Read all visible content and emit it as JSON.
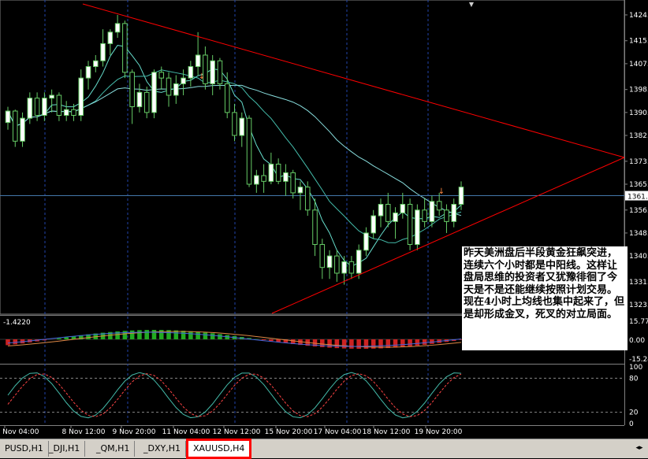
{
  "chart_data": [
    {
      "type": "candlestick",
      "symbol": "XAUUSD,H4",
      "y_ticks": [
        "1424.",
        "1415.",
        "1407.",
        "1398.",
        "1390.",
        "1382.",
        "1373.",
        "1365.",
        "1356.",
        "1348.",
        "1340.",
        "1331.",
        "1323."
      ],
      "current_price_label": "1361.",
      "ylim": [
        1320,
        1427
      ],
      "x_ticks": [
        "5 Nov 04:00",
        "8 Nov 12:00",
        "9 Nov 20:00",
        "11 Nov 04:00",
        "12 Nov 12:00",
        "15 Nov 20:00",
        "17 Nov 04:00",
        "18 Nov 12:00",
        "19 Nov 20:00"
      ],
      "candles": [
        [
          1386.5,
          1392,
          1384,
          1390.5
        ],
        [
          1390.5,
          1391,
          1378,
          1380
        ],
        [
          1380,
          1390,
          1378,
          1388
        ],
        [
          1388,
          1397,
          1386,
          1395
        ],
        [
          1395,
          1397,
          1387,
          1389
        ],
        [
          1389,
          1397,
          1387,
          1395
        ],
        [
          1395,
          1398,
          1390,
          1396
        ],
        [
          1396,
          1397,
          1387,
          1389
        ],
        [
          1389,
          1394,
          1387,
          1391
        ],
        [
          1391,
          1393,
          1387,
          1389
        ],
        [
          1389,
          1405,
          1387,
          1402
        ],
        [
          1402,
          1408,
          1398,
          1406
        ],
        [
          1406,
          1410,
          1404,
          1408
        ],
        [
          1408,
          1419,
          1406,
          1414
        ],
        [
          1414,
          1419,
          1410,
          1418
        ],
        [
          1418,
          1424,
          1416,
          1421
        ],
        [
          1421,
          1422,
          1402,
          1404
        ],
        [
          1404,
          1405,
          1386,
          1392
        ],
        [
          1392,
          1400,
          1390,
          1397
        ],
        [
          1397,
          1399,
          1388,
          1390
        ],
        [
          1390,
          1405,
          1388,
          1404
        ],
        [
          1404,
          1406,
          1398,
          1402
        ],
        [
          1402,
          1404,
          1392,
          1396
        ],
        [
          1396,
          1403,
          1393,
          1400
        ],
        [
          1400,
          1405,
          1396,
          1402
        ],
        [
          1402,
          1408,
          1399,
          1406
        ],
        [
          1406,
          1418,
          1403,
          1410
        ],
        [
          1410,
          1413,
          1398,
          1400
        ],
        [
          1400,
          1410,
          1396,
          1408
        ],
        [
          1408,
          1409,
          1398,
          1400
        ],
        [
          1400,
          1404,
          1388,
          1390
        ],
        [
          1390,
          1393,
          1380,
          1382
        ],
        [
          1382,
          1390,
          1378,
          1388
        ],
        [
          1388,
          1389,
          1364,
          1365
        ],
        [
          1365,
          1370,
          1362,
          1368
        ],
        [
          1368,
          1372,
          1362,
          1366
        ],
        [
          1366,
          1376,
          1365,
          1372
        ],
        [
          1372,
          1374,
          1365,
          1366
        ],
        [
          1366,
          1372,
          1361,
          1369
        ],
        [
          1369,
          1370,
          1360,
          1362
        ],
        [
          1362,
          1366,
          1356,
          1364
        ],
        [
          1364,
          1366,
          1354,
          1356
        ],
        [
          1356,
          1360,
          1340,
          1344
        ],
        [
          1344,
          1346,
          1332,
          1336
        ],
        [
          1336,
          1342,
          1332,
          1340
        ],
        [
          1340,
          1342,
          1331,
          1334
        ],
        [
          1334,
          1340,
          1330,
          1338
        ],
        [
          1338,
          1340,
          1332,
          1334
        ],
        [
          1334,
          1344,
          1332,
          1342
        ],
        [
          1342,
          1350,
          1340,
          1348
        ],
        [
          1348,
          1356,
          1346,
          1354
        ],
        [
          1354,
          1360,
          1350,
          1358
        ],
        [
          1358,
          1362,
          1350,
          1352
        ],
        [
          1352,
          1357,
          1346,
          1355
        ],
        [
          1355,
          1362,
          1353,
          1358
        ],
        [
          1358,
          1360,
          1342,
          1344
        ],
        [
          1344,
          1358,
          1342,
          1356
        ],
        [
          1356,
          1360,
          1350,
          1352
        ],
        [
          1352,
          1361,
          1350,
          1359
        ],
        [
          1359,
          1362,
          1354,
          1356
        ],
        [
          1356,
          1358,
          1348,
          1352
        ],
        [
          1352,
          1360,
          1350,
          1358
        ],
        [
          1358,
          1366,
          1356,
          1364
        ]
      ]
    },
    {
      "type": "histogram",
      "indicator": "MACD",
      "value_label": "-1.4220",
      "y_ticks": [
        "15.7715",
        "0.00",
        "-15.24"
      ]
    },
    {
      "type": "line",
      "indicator": "Stochastic",
      "y_ticks": [
        "100",
        "80",
        "20",
        "0"
      ]
    }
  ],
  "annotation": {
    "text": "昨天美洲盘后半段黄金狂飙突进，连续六个小时都是中阳线。这样让盘局思维的投资者又犹豫徘徊了今天是不是还能继续按照计划交易。现在4小时上均线也集中起来了，但是却形成金叉，死叉的对立局面。"
  },
  "tabs": [
    {
      "label": "PUSD,H1",
      "active": false
    },
    {
      "label": "_DJI,H1",
      "active": false
    },
    {
      "label": "_QM,H1",
      "active": false
    },
    {
      "label": "_DXY,H1",
      "active": false
    },
    {
      "label": "XAUUSD,H4",
      "active": true
    }
  ],
  "colors": {
    "bull": "#ffffff",
    "bear": "#000000",
    "wick": "#66cc66",
    "trendline": "#ff0000",
    "grid": "#2244aa",
    "macd_up": "#22aa22",
    "macd_down": "#cc2222"
  }
}
